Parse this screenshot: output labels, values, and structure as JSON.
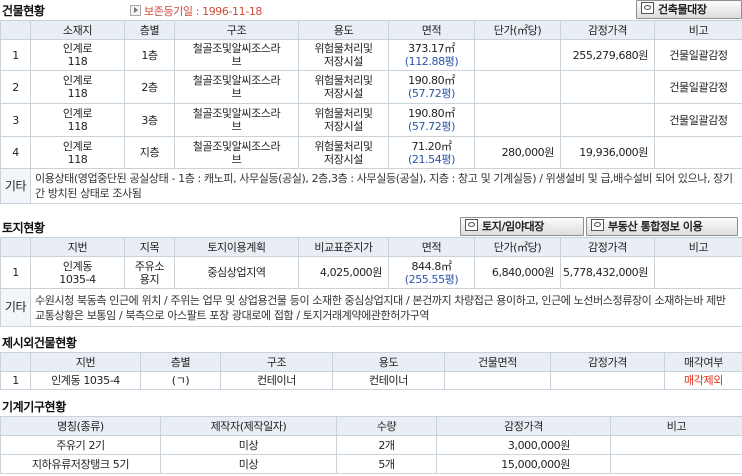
{
  "building": {
    "title": "건물현황",
    "preserve_label": "보존등기일 : 1996-11-18",
    "btn_register": "건축물대장",
    "headers": [
      "",
      "소재지",
      "층별",
      "구조",
      "용도",
      "면적",
      "단가(㎡당)",
      "감정가격",
      "비고"
    ],
    "rows": [
      {
        "no": "1",
        "loc": "인계로\n118",
        "floor": "1층",
        "struct": "철골조및알씨조스라\n브",
        "use": "위험물처리및\n저장시설",
        "area": "373.17㎡",
        "area_py": "(112.88평)",
        "unit": "",
        "price": "255,279,680원",
        "note": "건물일괄감정"
      },
      {
        "no": "2",
        "loc": "인계로\n118",
        "floor": "2층",
        "struct": "철골조및알씨조스라\n브",
        "use": "위험물처리및\n저장시설",
        "area": "190.80㎡",
        "area_py": "(57.72평)",
        "unit": "",
        "price": "",
        "note": "건물일괄감정"
      },
      {
        "no": "3",
        "loc": "인계로\n118",
        "floor": "3층",
        "struct": "철골조및알씨조스라\n브",
        "use": "위험물처리및\n저장시설",
        "area": "190.80㎡",
        "area_py": "(57.72평)",
        "unit": "",
        "price": "",
        "note": "건물일괄감정"
      },
      {
        "no": "4",
        "loc": "인계로\n118",
        "floor": "지층",
        "struct": "철골조및알씨조스라\n브",
        "use": "위험물처리및\n저장시설",
        "area": "71.20㎡",
        "area_py": "(21.54평)",
        "unit": "280,000원",
        "price": "19,936,000원",
        "note": ""
      }
    ],
    "etc_label": "기타",
    "etc_text": "이용상태(영업중단된 공실상태 - 1층 : 캐노피, 사무실등(공실), 2층,3층 : 사무실등(공실), 지층 : 창고 및 기계실등) / 위생설비 및 급,배수설비 되어 있으나, 장기간 방치된 상태로 조사됨"
  },
  "land": {
    "title": "토지현황",
    "btn_land": "토지/임야대장",
    "btn_info": "부동산 통합정보 이용",
    "headers": [
      "",
      "지번",
      "지목",
      "토지이용계획",
      "비교표준지가",
      "면적",
      "단가(㎡당)",
      "감정가격",
      "비고"
    ],
    "rows": [
      {
        "no": "1",
        "lot": "인계동\n1035-4",
        "cat": "주유소\n용지",
        "plan": "중심상업지역",
        "std": "4,025,000원",
        "area": "844.8㎡",
        "area_py": "(255.55평)",
        "unit": "6,840,000원",
        "price": "5,778,432,000원",
        "note": ""
      }
    ],
    "etc_label": "기타",
    "etc_text": "수원시청 북동측 인근에 위치 / 주위는 업무 및 상업용건물 등이 소재한 중심상업지대 / 본건까지 차량접근 용이하고, 인근에 노선버스정류장이 소재하는바 제반 교통상황은 보통임 / 북측으로 아스팔트 포장 광대로에 접함 / 토지거래계약에관한허가구역"
  },
  "excluded": {
    "title": "제시외건물현황",
    "headers": [
      "",
      "지번",
      "층별",
      "구조",
      "용도",
      "건물면적",
      "감정가격",
      "매각여부"
    ],
    "rows": [
      {
        "no": "1",
        "lot": "인계동 1035-4",
        "floor": "(ㄱ)",
        "struct": "컨테이너",
        "use": "컨테이너",
        "area": "",
        "price": "",
        "sale": "매각제외"
      }
    ]
  },
  "machines": {
    "title": "기계기구현황",
    "headers": [
      "명칭(종류)",
      "제작자(제작일자)",
      "수량",
      "감정가격",
      "비고"
    ],
    "rows": [
      {
        "name": "주유기 2기",
        "maker": "미상",
        "qty": "2개",
        "price": "3,000,000원",
        "note": ""
      },
      {
        "name": "지하유류저장탱크 5기",
        "maker": "미상",
        "qty": "5개",
        "price": "15,000,000원",
        "note": ""
      }
    ]
  },
  "colors": {
    "header_bg": "#e9eef5",
    "border": "#c9d1da",
    "area_blue": "#2c54a8",
    "sale_red": "#e0301f",
    "preserve_red": "#d04a3a"
  }
}
